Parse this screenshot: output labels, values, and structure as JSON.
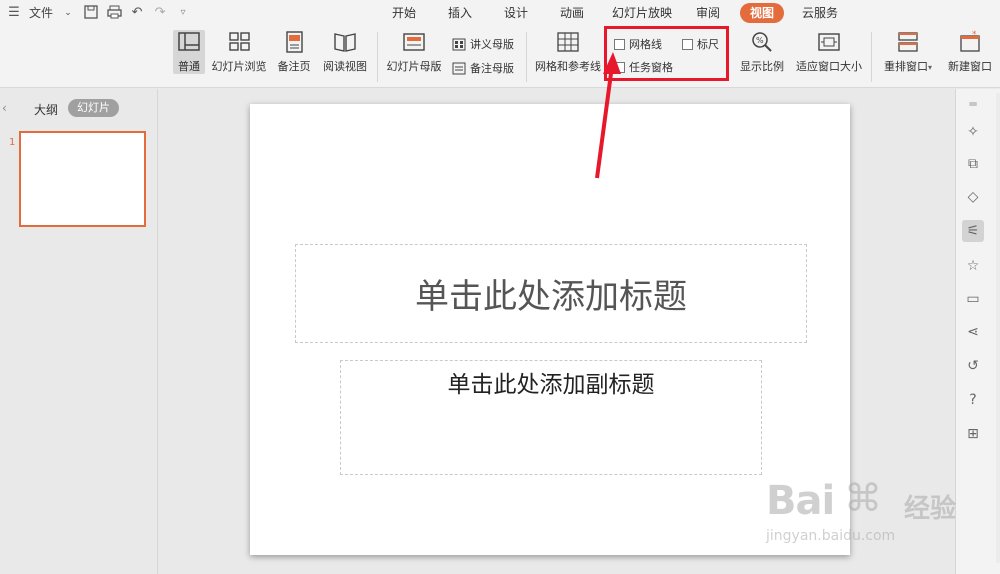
{
  "menubar": {
    "file_label": "文件",
    "tabs": [
      {
        "label": "开始",
        "active": false
      },
      {
        "label": "插入",
        "active": false
      },
      {
        "label": "设计",
        "active": false
      },
      {
        "label": "动画",
        "active": false
      },
      {
        "label": "幻灯片放映",
        "active": false
      },
      {
        "label": "审阅",
        "active": false
      },
      {
        "label": "视图",
        "active": true
      },
      {
        "label": "云服务",
        "active": false
      }
    ]
  },
  "ribbon": {
    "normal": "普通",
    "slide_sorter": "幻灯片浏览",
    "notes_page": "备注页",
    "reading_view": "阅读视图",
    "slide_master": "幻灯片母版",
    "handout_master": "讲义母版",
    "notes_master": "备注母版",
    "grid_guides": "网格和参考线",
    "gridlines_checkbox": {
      "label": "网格线",
      "checked": false
    },
    "ruler_checkbox": {
      "label": "标尺",
      "checked": false
    },
    "task_pane_checkbox": {
      "label": "任务窗格",
      "checked": false
    },
    "zoom": "显示比例",
    "fit_window": "适应窗口大小",
    "arrange_windows": "重排窗口",
    "new_window": "新建窗口"
  },
  "left_panel": {
    "outline_tab": "大纲",
    "slides_tab": "幻灯片",
    "thumbnail_number": "1"
  },
  "slide": {
    "title_placeholder": "单击此处添加标题",
    "subtitle_placeholder": "单击此处添加副标题"
  },
  "colors": {
    "accent": "#e46b3c",
    "highlight": "#e8182c"
  },
  "watermark": {
    "brand": "Bai",
    "brand_cn": "经验",
    "url": "jingyan.baidu.com"
  }
}
